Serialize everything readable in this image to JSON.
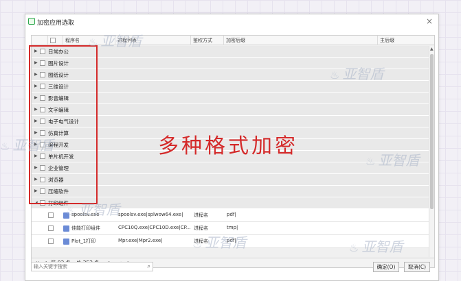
{
  "window": {
    "title": "加密应用选取",
    "close_glyph": "×"
  },
  "columns": [
    "程序名",
    "进程列表",
    "鉴权方式",
    "加密后缀",
    "主后缀"
  ],
  "groups": [
    "日常办公",
    "图片设计",
    "图纸设计",
    "三维设计",
    "影音编辑",
    "文字编辑",
    "电子电气设计",
    "仿真计算",
    "编程开发",
    "单片机开发",
    "企业管理",
    "浏览器",
    "压缩软件",
    "打印组件"
  ],
  "rows": [
    {
      "name": "spoolsv.exe",
      "process": "spoolsv.exe|splwow64.exe|",
      "auth": "进程名",
      "suffix": "pdf|"
    },
    {
      "name": "佳能打印组件",
      "process": "CPC10Q.exe|CPC10D.exe|CP...",
      "auth": "进程名",
      "suffix": "tmp|"
    },
    {
      "name": "Plot_1打印",
      "process": "Mpr.exe|Mpr2.exe|",
      "auth": "进程名",
      "suffix": "pdf|"
    }
  ],
  "pager": {
    "first": "⏮",
    "prev": "◀",
    "text": "第 92 条，总 252 条",
    "next": "▶",
    "last": "⏭",
    "add": "+",
    "remove": "-"
  },
  "search": {
    "placeholder": "输入关键字搜索",
    "value": ""
  },
  "buttons": {
    "ok": "确定(O)",
    "cancel": "取消(C)"
  },
  "overlay": {
    "text": "多种格式加密",
    "color": "#d42a2a"
  },
  "watermark": {
    "text": "亚智盾"
  }
}
